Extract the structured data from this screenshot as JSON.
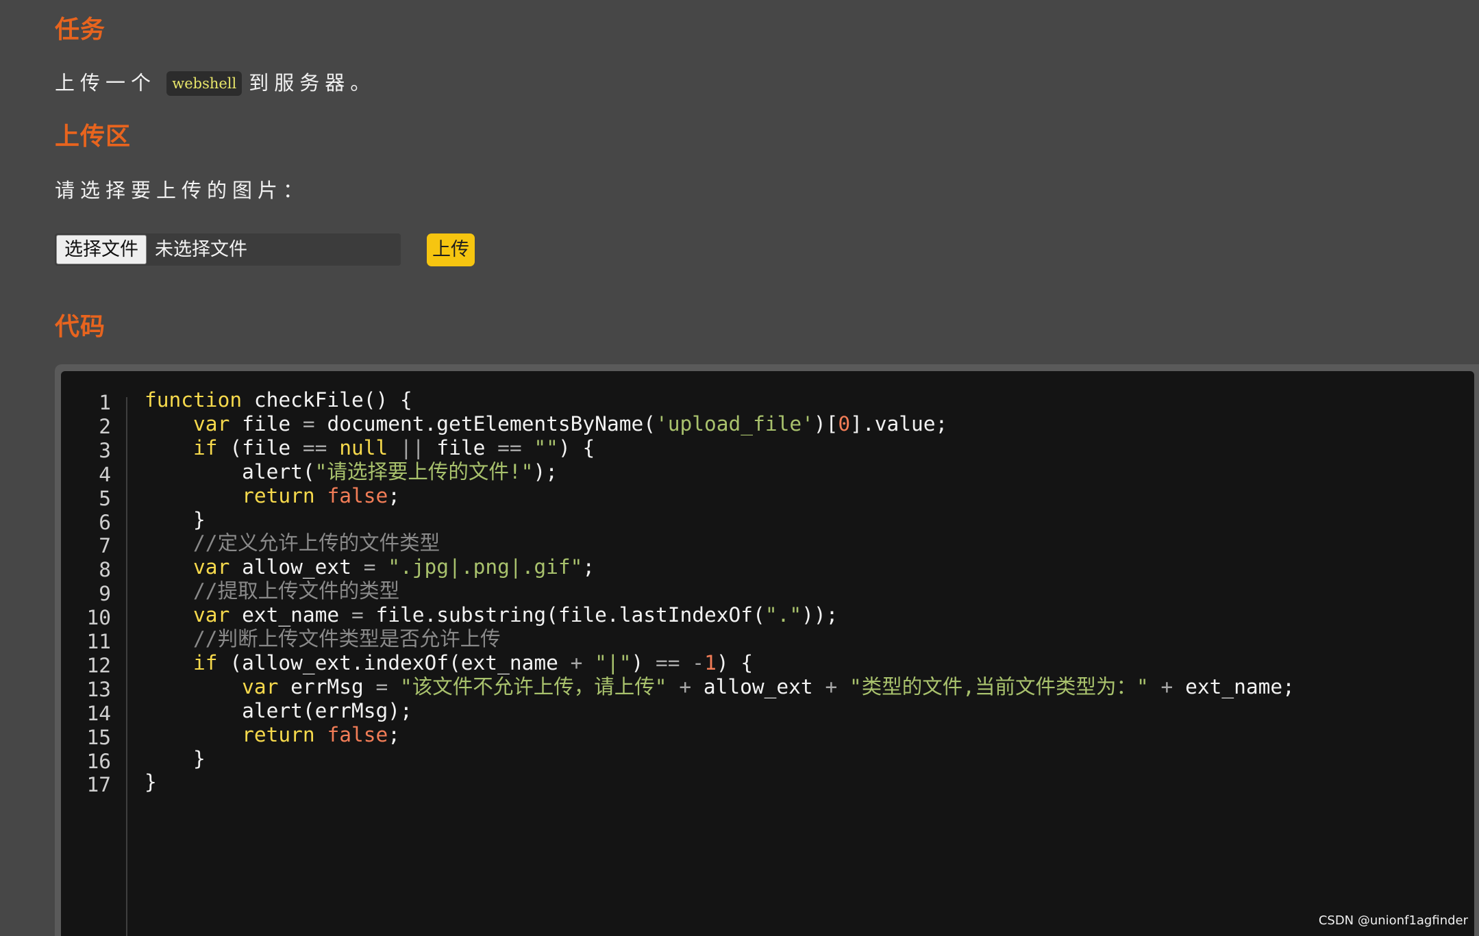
{
  "sections": {
    "task_heading": "任务",
    "task_text_before": "上传一个",
    "task_tag": "webshell",
    "task_text_after": "到服务器。",
    "upload_heading": "上传区",
    "upload_prompt": "请选择要上传的图片：",
    "code_heading": "代码"
  },
  "upload": {
    "choose_label": "选择文件",
    "no_file_label": "未选择文件",
    "submit_label": "上传"
  },
  "code": {
    "line_numbers": [
      "1",
      "2",
      "3",
      "4",
      "5",
      "6",
      "7",
      "8",
      "9",
      "10",
      "11",
      "12",
      "13",
      "14",
      "15",
      "16",
      "17"
    ],
    "lines": [
      "function checkFile() {",
      "    var file = document.getElementsByName('upload_file')[0].value;",
      "    if (file == null || file == \"\") {",
      "        alert(\"请选择要上传的文件!\");",
      "        return false;",
      "    }",
      "    //定义允许上传的文件类型",
      "    var allow_ext = \".jpg|.png|.gif\";",
      "    //提取上传文件的类型",
      "    var ext_name = file.substring(file.lastIndexOf(\".\"));",
      "    //判断上传文件类型是否允许上传",
      "    if (allow_ext.indexOf(ext_name + \"|\") == -1) {",
      "        var errMsg = \"该文件不允许上传，请上传\" + allow_ext + \"类型的文件,当前文件类型为：\" + ext_name;",
      "        alert(errMsg);",
      "        return false;",
      "    }",
      "}"
    ]
  },
  "watermark": "CSDN @unionf1agfinder"
}
